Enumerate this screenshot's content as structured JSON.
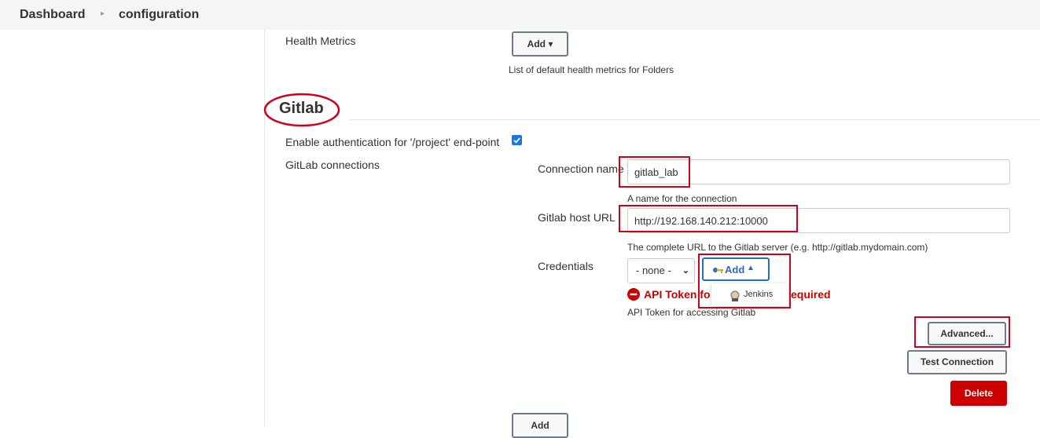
{
  "breadcrumb": {
    "home": "Dashboard",
    "current": "configuration"
  },
  "health_metrics": {
    "label": "Health Metrics",
    "add_button": "Add ▾",
    "help": "List of default health metrics for Folders"
  },
  "gitlab": {
    "section_title": "Gitlab",
    "enable_auth_label": "Enable authentication for '/project' end-point",
    "enable_auth_checked": true,
    "connections_label": "GitLab connections",
    "connection_name_label": "Connection name",
    "connection_name_value": "gitlab_lab",
    "connection_name_help": "A name for the connection",
    "host_url_label": "Gitlab host URL",
    "host_url_value": "http://192.168.140.212:10000",
    "host_url_help": "The complete URL to the Gitlab server (e.g. http://gitlab.mydomain.com)",
    "credentials_label": "Credentials",
    "credentials_select": "- none -",
    "credentials_add": "Add",
    "credentials_menu_item": "Jenkins",
    "error_left": "API Token fo",
    "error_right": "equired",
    "token_help": "API Token for accessing Gitlab",
    "advanced_button": "Advanced...",
    "test_button": "Test Connection",
    "delete_button": "Delete",
    "add_connection_button": "Add"
  },
  "colors": {
    "error": "#cc0000",
    "delete_bg": "#cc0000",
    "annotation": "#d0021b",
    "checkbox": "#1a73e8"
  }
}
